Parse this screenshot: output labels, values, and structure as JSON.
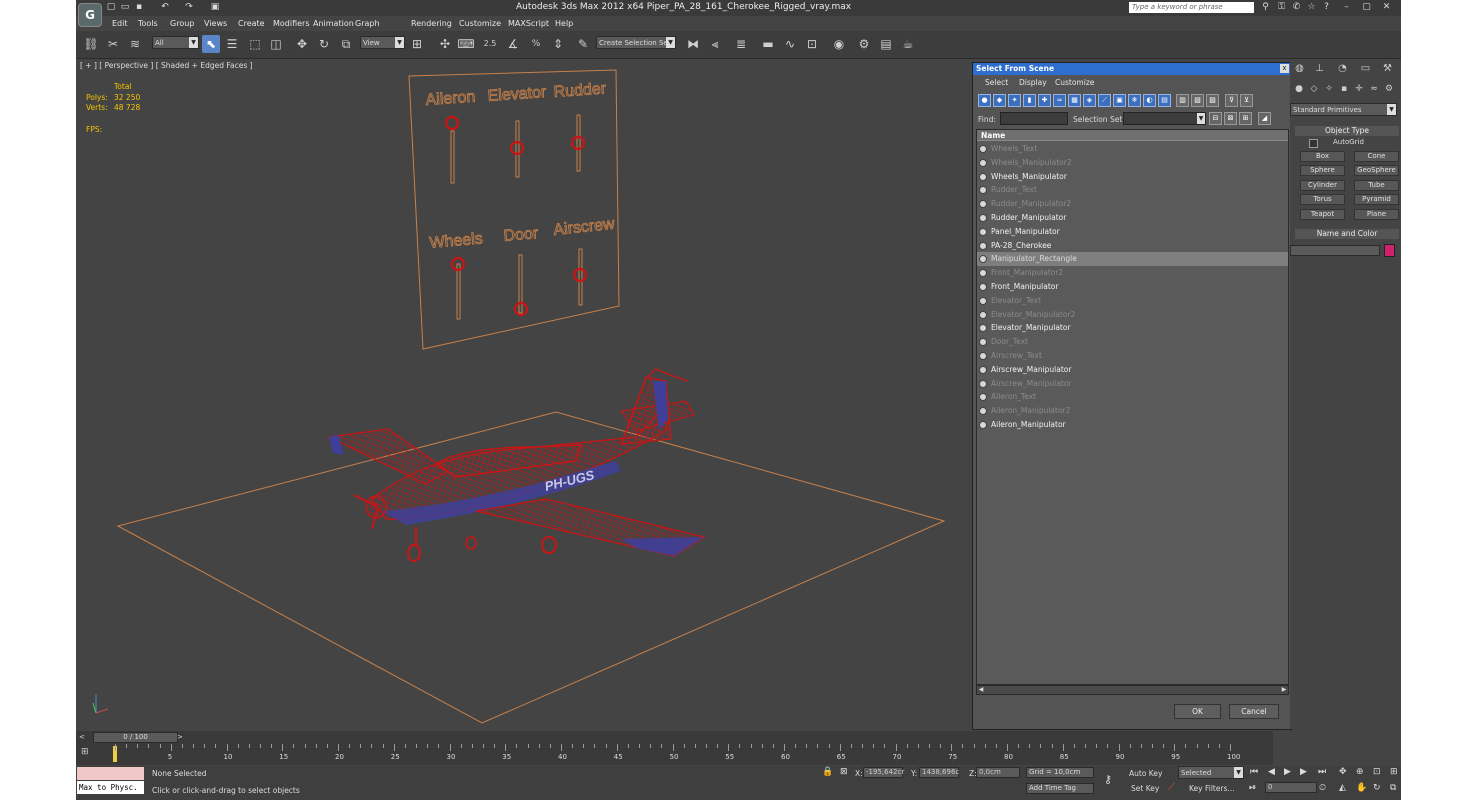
{
  "window": {
    "title": "Autodesk 3ds Max  2012 x64      Piper_PA_28_161_Cherokee_Rigged_vray.max",
    "logo": "G",
    "search_placeholder": "Type a keyword or phrase"
  },
  "menu": [
    "Edit",
    "Tools",
    "Group",
    "Views",
    "Create",
    "Modifiers",
    "Animation",
    "Graph Editors",
    "Rendering",
    "Customize",
    "MAXScript",
    "Help"
  ],
  "toolbar": {
    "filter_value": "All",
    "ref_coord_value": "View",
    "snap_angle_label": "2.5",
    "snap_pct_label": "%",
    "named_selection_value": "Create Selection Se"
  },
  "viewport": {
    "label": "[ + ] [ Perspective ] [ Shaded + Edged Faces ]",
    "stats": {
      "total_label": "Total",
      "polys_label": "Polys:",
      "polys_value": "32 250",
      "verts_label": "Verts:",
      "verts_value": "48 728",
      "fps_label": "FPS:"
    },
    "panel_labels": [
      "Aileron",
      "Elevator",
      "Rudder",
      "Wheels",
      "Door",
      "Airscrew"
    ],
    "plane_registration": "PH-UGS",
    "wire_color": "#cc1414",
    "grid_color": "#c8814a"
  },
  "dialog": {
    "title": "Select From Scene",
    "close_glyph": "x",
    "menus": [
      "Select",
      "Display",
      "Customize"
    ],
    "find_label": "Find:",
    "selection_set_label": "Selection Set:",
    "column_name": "Name",
    "items": [
      {
        "name": "Wheels_Text",
        "state": "dim"
      },
      {
        "name": "Wheels_Manipulator2",
        "state": "dim"
      },
      {
        "name": "Wheels_Manipulator",
        "state": "norm"
      },
      {
        "name": "Rudder_Text",
        "state": "dim"
      },
      {
        "name": "Rudder_Manipulator2",
        "state": "dim"
      },
      {
        "name": "Rudder_Manipulator",
        "state": "norm"
      },
      {
        "name": "Panel_Manipulator",
        "state": "norm"
      },
      {
        "name": "PA-28_Cherokee",
        "state": "norm"
      },
      {
        "name": "Manipulator_Rectangle",
        "state": "sel"
      },
      {
        "name": "Front_Manipulator2",
        "state": "dim"
      },
      {
        "name": "Front_Manipulator",
        "state": "norm"
      },
      {
        "name": "Elevator_Text",
        "state": "dim"
      },
      {
        "name": "Elevator_Manipulator2",
        "state": "dim"
      },
      {
        "name": "Elevator_Manipulator",
        "state": "norm"
      },
      {
        "name": "Door_Text",
        "state": "dim"
      },
      {
        "name": "Airscrew_Text",
        "state": "dim"
      },
      {
        "name": "Airscrew_Manipulator",
        "state": "norm"
      },
      {
        "name": "Airscrew_Manipulator",
        "state": "dim"
      },
      {
        "name": "Aileron_Text",
        "state": "dim"
      },
      {
        "name": "Aileron_Manipulator2",
        "state": "dim"
      },
      {
        "name": "Aileron_Manipulator",
        "state": "norm"
      }
    ],
    "ok_label": "OK",
    "cancel_label": "Cancel"
  },
  "command_panel": {
    "category_value": "Standard Primitives",
    "object_type_title": "Object Type",
    "autogrid_label": "AutoGrid",
    "primitives": [
      "Box",
      "Cone",
      "Sphere",
      "GeoSphere",
      "Cylinder",
      "Tube",
      "Torus",
      "Pyramid",
      "Teapot",
      "Plane"
    ],
    "name_color_title": "Name and Color",
    "object_color": "#d0206e"
  },
  "timeline": {
    "frame_label": "0 / 100",
    "ticks": [
      "5",
      "10",
      "15",
      "20",
      "25",
      "30",
      "35",
      "40",
      "45",
      "50",
      "55",
      "60",
      "65",
      "70",
      "75",
      "80",
      "85",
      "90",
      "95",
      "100"
    ]
  },
  "status": {
    "maxscript_label": "Max to Physc.",
    "selection_text": "None Selected",
    "prompt_text": "Click or click-and-drag to select objects",
    "x_label": "X:",
    "x_value": "-195,642cr",
    "y_label": "Y:",
    "y_value": "1438,696c",
    "z_label": "Z:",
    "z_value": "0,0cm",
    "grid_text": "Grid = 10,0cm",
    "add_time_tag": "Add Time Tag",
    "auto_key_label": "Auto Key",
    "set_key_label": "Set Key",
    "key_mode_value": "Selected",
    "key_filters_label": "Key Filters...",
    "current_frame": "0"
  }
}
